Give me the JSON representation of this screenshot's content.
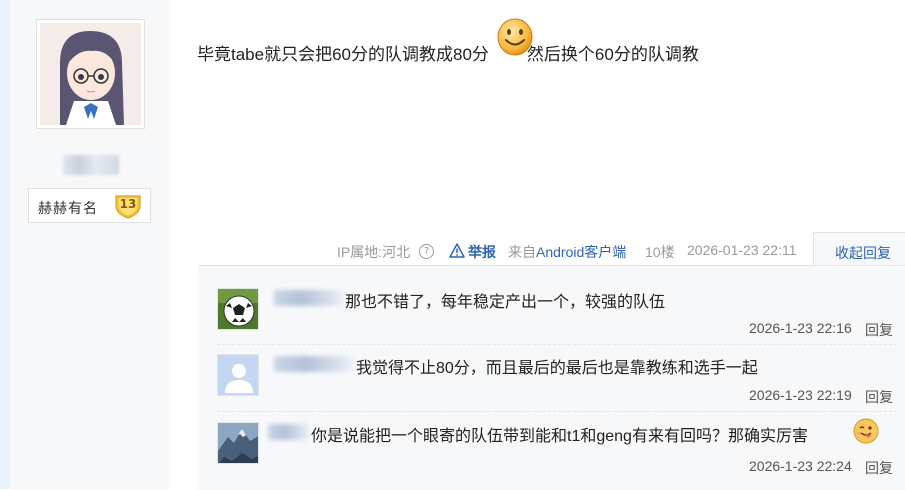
{
  "author": {
    "level_name": "赫赫有名",
    "level_number": "13"
  },
  "post": {
    "content_before": "毕竟tabe就只会把60分的队调教成80分",
    "content_after": "然后换个60分的队调教",
    "emoticon": "smiley-face"
  },
  "meta": {
    "ip_location": "IP属地:河北",
    "report_label": "举报",
    "client_prefix": "来自",
    "client_name": "Android客户端",
    "floor": "10楼",
    "time": "2026-01-23 22:11",
    "collapse_label": "收起回复"
  },
  "replies": [
    {
      "text": "那也不错了，每年稳定产出一个，较强的队伍",
      "time": "2026-1-23 22:16",
      "reply_label": "回复",
      "avatar": "soccer-ball"
    },
    {
      "text": "我觉得不止80分，而且最后的最后也是靠教练和选手一起",
      "time": "2026-1-23 22:19",
      "reply_label": "回复",
      "avatar": "default-person"
    },
    {
      "text": "你是说能把一个眼寄的队伍带到能和t1和geng有来有回吗？那确实厉害",
      "time": "2026-1-23 22:24",
      "reply_label": "回复",
      "avatar": "mountain-photo",
      "emoticon": "tongue-face"
    }
  ],
  "colors": {
    "link": "#2d64b3",
    "muted": "#999999",
    "reply_bg": "#f7f8fa"
  }
}
